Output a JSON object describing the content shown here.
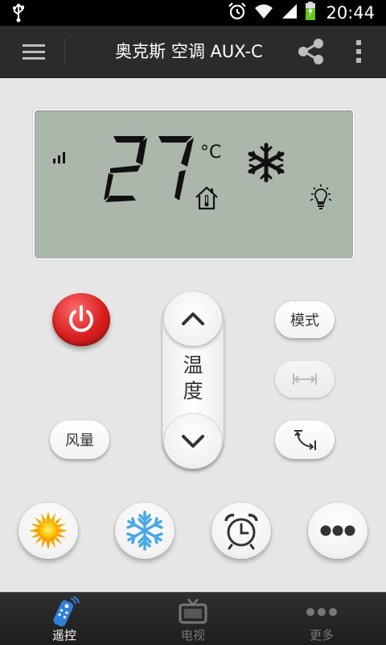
{
  "status_bar": {
    "time": "20:44",
    "icons": [
      "usb-icon",
      "alarm-icon",
      "wifi-icon",
      "cell-signal-icon",
      "battery-charging-icon"
    ]
  },
  "action_bar": {
    "title": "奥克斯 空调 AUX-C",
    "icons": [
      "menu-icon",
      "share-icon",
      "overflow-menu-icon"
    ]
  },
  "lcd": {
    "temperature": "27",
    "unit": "°C",
    "icons": [
      "fan-speed-bars-icon",
      "home-thermometer-icon",
      "snowflake-icon",
      "light-bulb-icon"
    ]
  },
  "controls": {
    "power_icon": "power-icon",
    "mode_label": "模式",
    "temp_label_line1": "温",
    "temp_label_line2": "度",
    "fan_label": "风量",
    "swing_horizontal_icon": "horizontal-swing-icon",
    "swing_vertical_icon": "vertical-swing-icon",
    "temp_up_icon": "chevron-up-icon",
    "temp_down_icon": "chevron-down-icon"
  },
  "quick_buttons": [
    "sun-icon",
    "snowflake-icon",
    "alarm-clock-icon",
    "more-dots-icon"
  ],
  "colors": {
    "lcd_background": "#aab7aa",
    "power_red": "#d81f1f",
    "nav_active": "#ffffff",
    "nav_inactive": "#777777",
    "remote_blue": "#2f7fd8"
  },
  "bottom_nav": {
    "items": [
      {
        "label": "遥控",
        "icon": "remote-control-icon",
        "active": true
      },
      {
        "label": "电视",
        "icon": "tv-icon",
        "active": false
      },
      {
        "label": "更多",
        "icon": "more-dots-icon",
        "active": false
      }
    ]
  }
}
